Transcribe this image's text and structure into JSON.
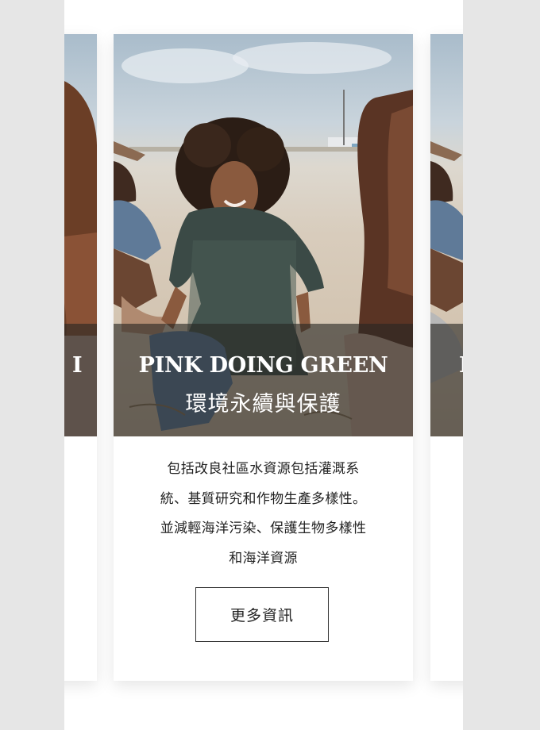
{
  "carousel": {
    "active_card": {
      "title_en": "PINK DOING GREEN",
      "title_zh": "環境永續與保護",
      "description_lines": [
        "包括改良社區水資源包括灌溉系",
        "統、基質研究和作物生產多樣性。",
        "並減輕海洋污染、保護生物多樣性",
        "和海洋資源"
      ],
      "more_button_label": "更多資訊"
    },
    "prev_card": {
      "title_partial": "I"
    },
    "next_card": {
      "title_partial": "I"
    }
  },
  "colors": {
    "page_background": "#e6e6e6",
    "card_background": "#ffffff",
    "overlay": "rgba(40,38,36,0.62)",
    "text": "#222222",
    "button_border": "#333333"
  }
}
